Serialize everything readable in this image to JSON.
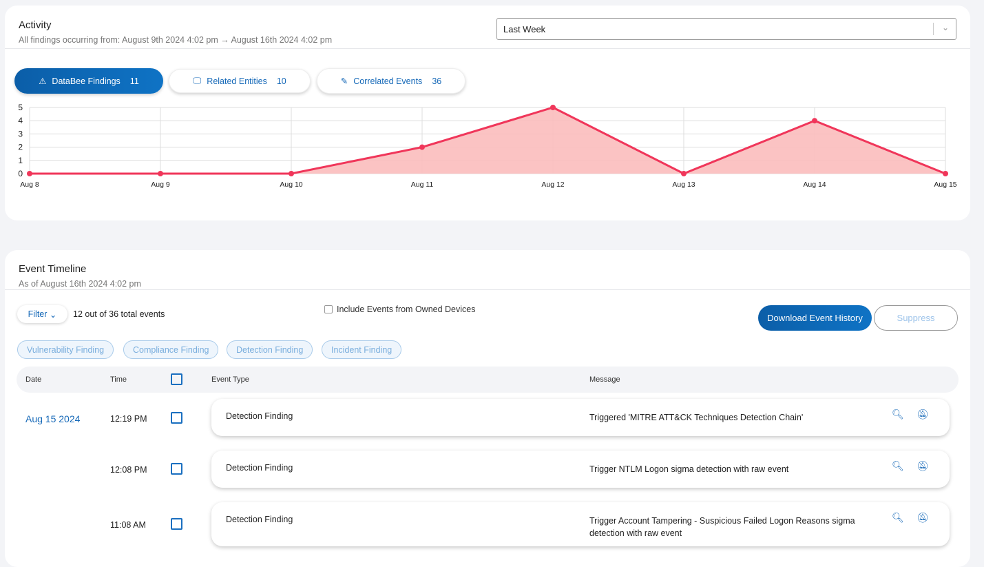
{
  "activity": {
    "title": "Activity",
    "subtitle": "All findings occurring from: August 9th 2024 4:02 pm → August 16th 2024 4:02 pm",
    "range": "Last Week",
    "tabs": [
      {
        "label": "DataBee Findings",
        "count": "11",
        "icon": "warning-icon"
      },
      {
        "label": "Related Entities",
        "count": "10",
        "icon": "monitor-icon"
      },
      {
        "label": "Correlated Events",
        "count": "36",
        "icon": "pencil-icon"
      }
    ]
  },
  "chart_data": {
    "type": "area",
    "categories": [
      "Aug 8",
      "Aug 9",
      "Aug 10",
      "Aug 11",
      "Aug 12",
      "Aug 13",
      "Aug 14",
      "Aug 15"
    ],
    "values": [
      0,
      0,
      0,
      2,
      5,
      0,
      4,
      0
    ],
    "ylim": [
      0,
      5
    ],
    "yticks": [
      0,
      1,
      2,
      3,
      4,
      5
    ],
    "grid": true,
    "colors": {
      "line": "#f0365a",
      "fill": "#fbbcbc"
    }
  },
  "timeline": {
    "title": "Event Timeline",
    "subtitle": "As of August 16th 2024 4:02 pm",
    "filter": "Filter",
    "count_text": "12 out of 36 total events",
    "include_owned": "Include Events from Owned Devices",
    "download": "Download Event History",
    "suppress": "Suppress",
    "chips": [
      "Vulnerability Finding",
      "Compliance Finding",
      "Detection Finding",
      "Incident Finding"
    ],
    "columns": {
      "date": "Date",
      "time": "Time",
      "type": "Event Type",
      "message": "Message"
    },
    "date_group": "Aug 15 2024",
    "rows": [
      {
        "time": "12:19 PM",
        "type": "Detection Finding",
        "message": "Triggered 'MITRE ATT&CK Techniques Detection Chain'"
      },
      {
        "time": "12:08 PM",
        "type": "Detection Finding",
        "message": "Trigger NTLM Logon sigma detection with raw event"
      },
      {
        "time": "11:08 AM",
        "type": "Detection Finding",
        "message": "Trigger Account Tampering - Suspicious Failed Logon Reasons sigma detection with raw event"
      }
    ]
  },
  "colors": {
    "accent": "#0f6abf"
  }
}
